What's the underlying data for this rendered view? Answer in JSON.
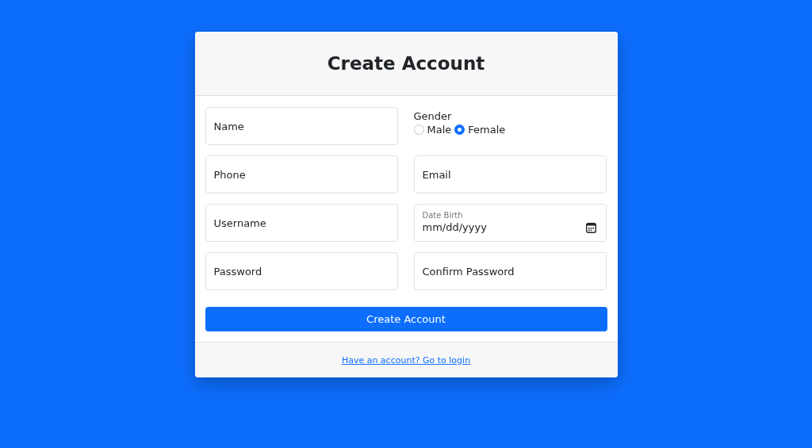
{
  "card": {
    "title": "Create Account"
  },
  "fields": [
    {
      "kind": "text",
      "placeholder": "Name"
    },
    {
      "kind": "radio",
      "label": "Gender",
      "options": [
        {
          "label": "Male",
          "selected": false
        },
        {
          "label": "Female",
          "selected": true
        }
      ]
    },
    {
      "kind": "text",
      "placeholder": "Phone"
    },
    {
      "kind": "text",
      "placeholder": "Email"
    },
    {
      "kind": "text",
      "placeholder": "Username"
    },
    {
      "kind": "date",
      "label": "Date Birth",
      "placeholder": "mm/dd/yyyy"
    },
    {
      "kind": "text",
      "placeholder": "Password"
    },
    {
      "kind": "text",
      "placeholder": "Confirm Password"
    }
  ],
  "submit": "Create Account",
  "footer_link": "Have an account? Go to login"
}
